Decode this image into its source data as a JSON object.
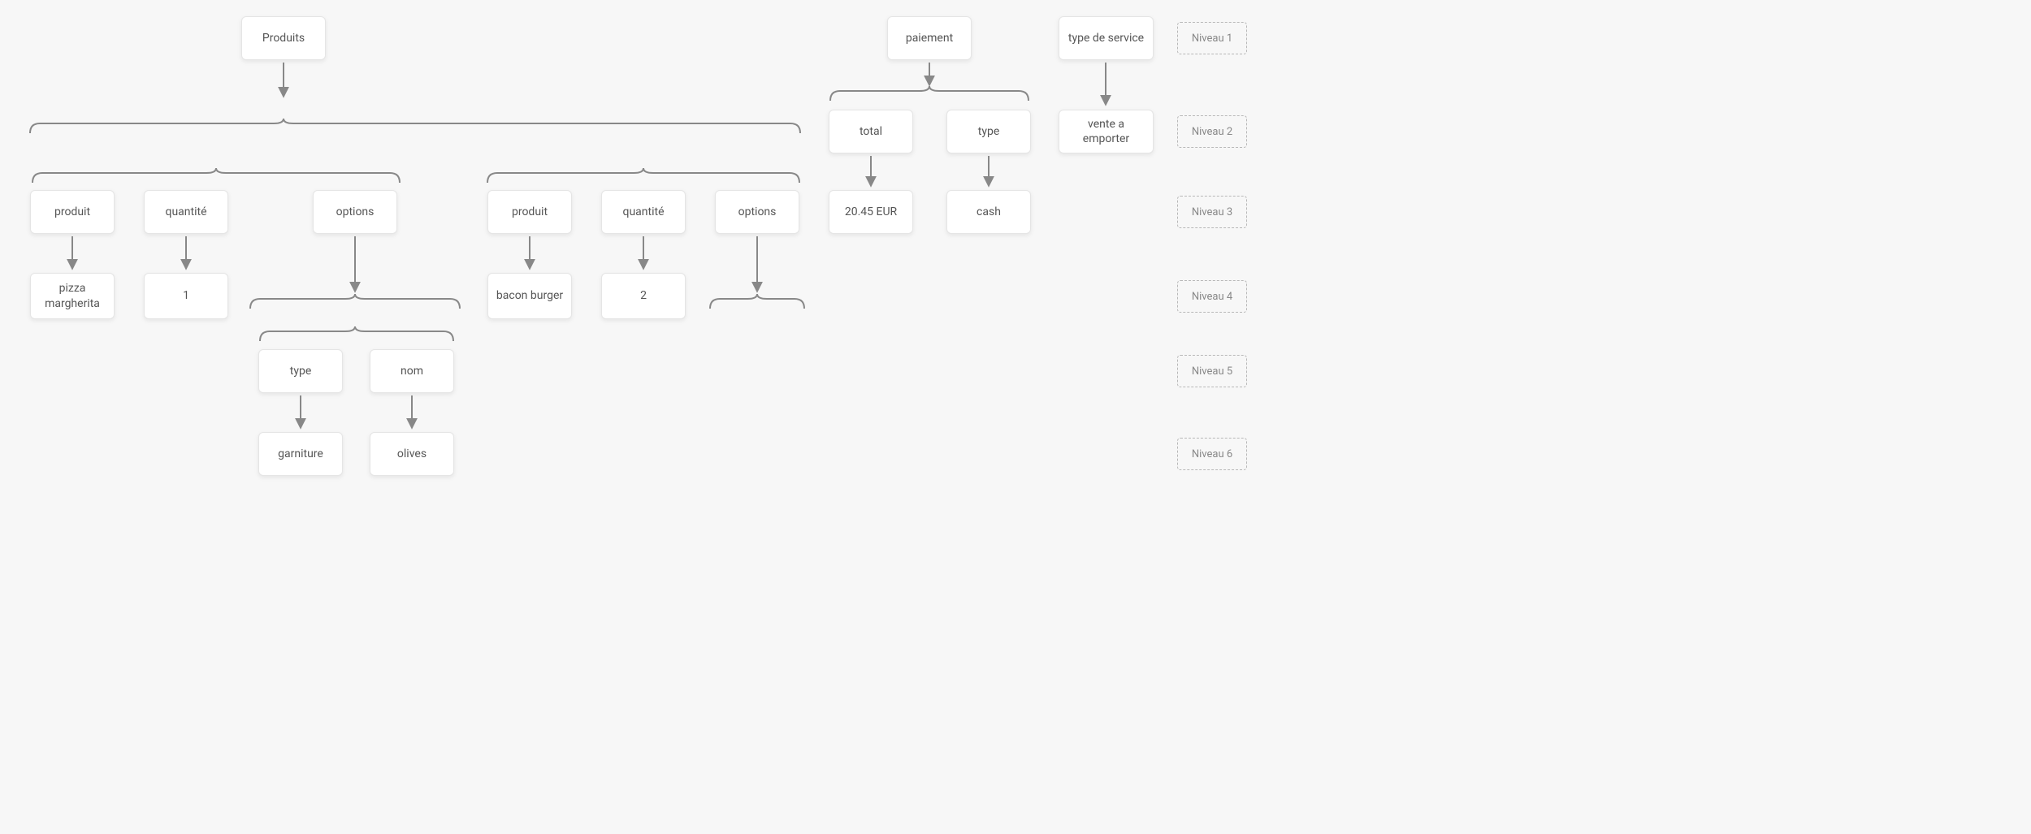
{
  "nodes": {
    "produits": "Produits",
    "paiement": "paiement",
    "type_service": "type de service",
    "total": "total",
    "type_paiement": "type",
    "vente_emporter": "vente a emporter",
    "produit_a": "produit",
    "quantite_a": "quantité",
    "options_a": "options",
    "produit_b": "produit",
    "quantite_b": "quantité",
    "options_b": "options",
    "total_val": "20.45 EUR",
    "type_paiement_val": "cash",
    "pizza": "pizza margherita",
    "qty1": "1",
    "bacon": "bacon burger",
    "qty2": "2",
    "opt_type": "type",
    "opt_nom": "nom",
    "garniture": "garniture",
    "olives": "olives"
  },
  "levels": {
    "l1": "Niveau 1",
    "l2": "Niveau 2",
    "l3": "Niveau 3",
    "l4": "Niveau 4",
    "l5": "Niveau 5",
    "l6": "Niveau 6"
  }
}
